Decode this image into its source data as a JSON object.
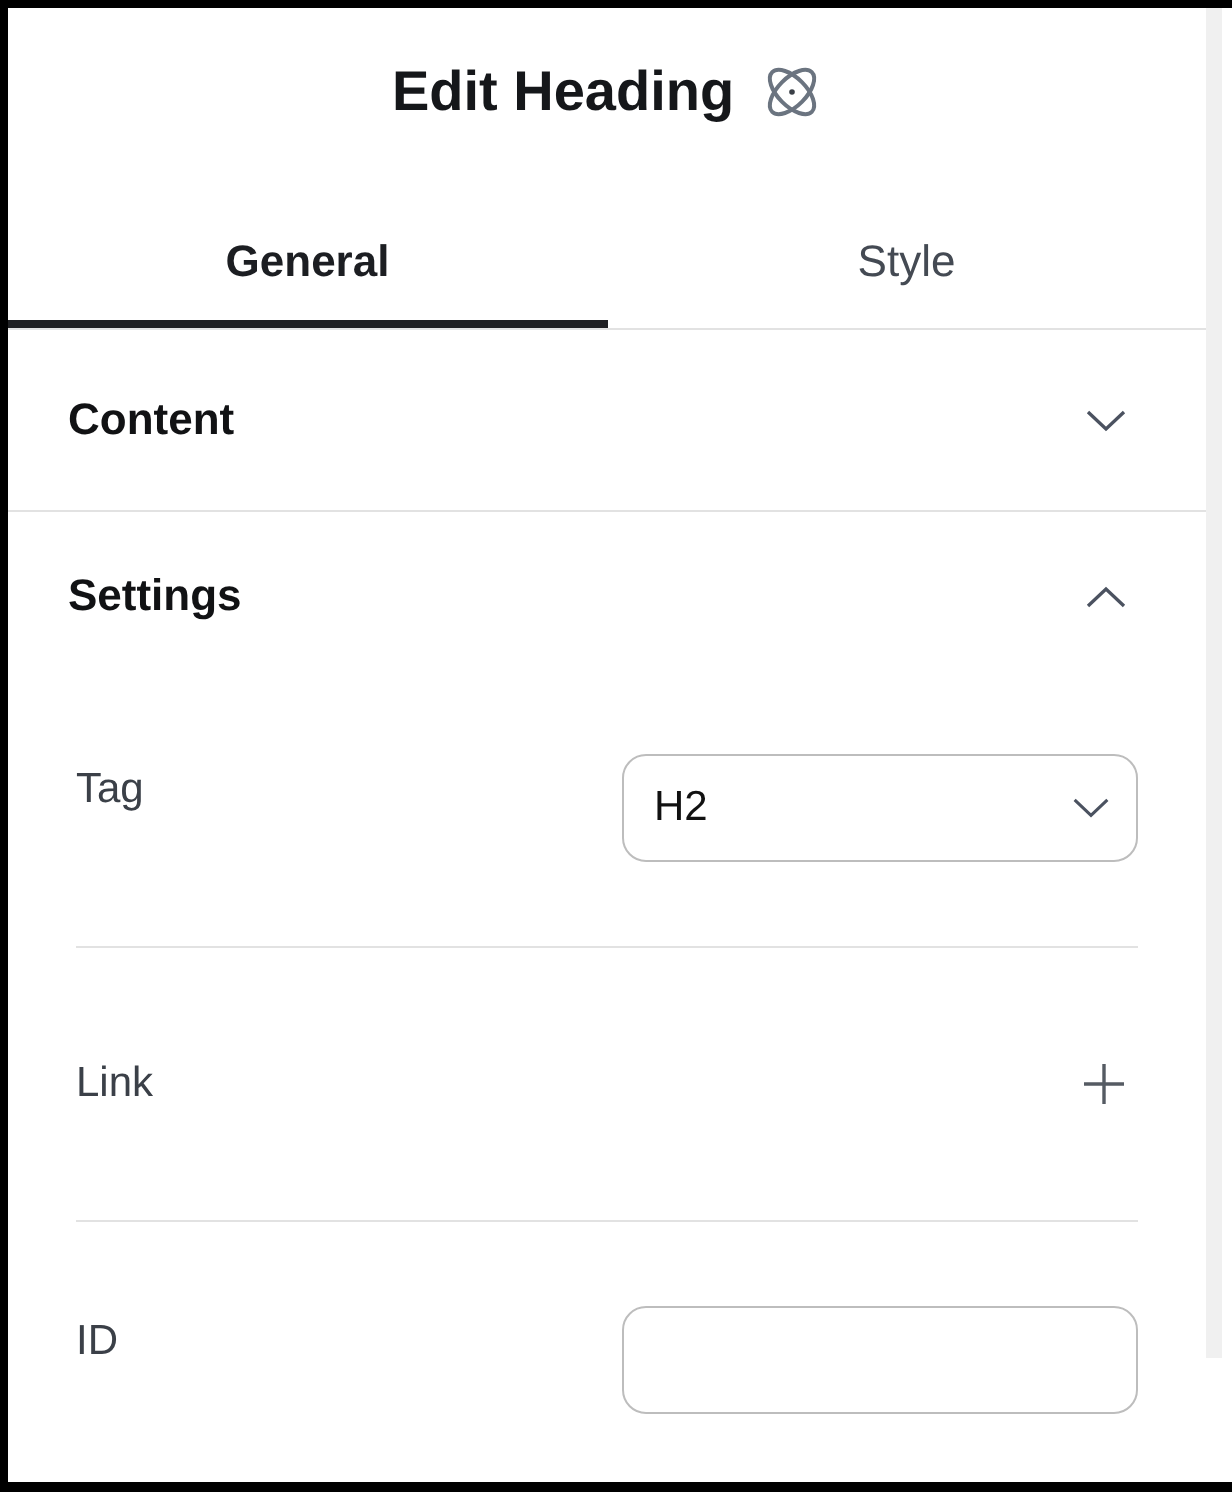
{
  "header": {
    "title": "Edit Heading"
  },
  "tabs": [
    {
      "label": "General",
      "selected": true
    },
    {
      "label": "Style",
      "selected": false
    }
  ],
  "sections": [
    {
      "title": "Content",
      "expanded": false
    },
    {
      "title": "Settings",
      "expanded": true,
      "fields": [
        {
          "kind": "select",
          "label": "Tag",
          "value": "H2"
        },
        {
          "kind": "link",
          "label": "Link"
        },
        {
          "kind": "text",
          "label": "ID"
        }
      ]
    }
  ]
}
